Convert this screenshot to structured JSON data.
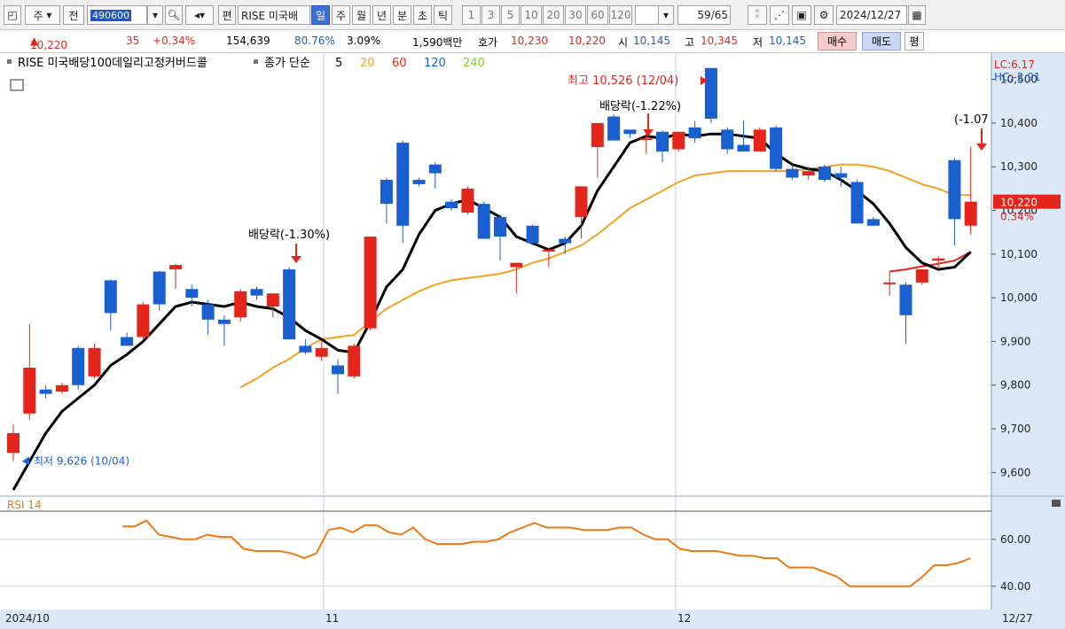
{
  "toolbar": {
    "period": "주",
    "prefix": "전",
    "code": "490600",
    "name": "RISE 미국배",
    "edit": "편",
    "tabs": [
      "일",
      "주",
      "월",
      "년",
      "분",
      "초",
      "틱"
    ],
    "active_tab": "일",
    "intervals": [
      "1",
      "3",
      "5",
      "10",
      "20",
      "30",
      "60",
      "120"
    ],
    "page": "59",
    "page_total": "/65",
    "date": "2024/12/27"
  },
  "quote": {
    "price": "10,220",
    "change": "35",
    "change_pct": "+0.34%",
    "volume": "154,639",
    "vol_ratio": "80.76%",
    "turnover": "3.09%",
    "amount": "1,590백만",
    "hoga_label": "호가",
    "ask": "10,230",
    "bid": "10,220",
    "open_label": "시",
    "open": "10,145",
    "high_label": "고",
    "high": "10,345",
    "low_label": "저",
    "low": "10,145",
    "buy_label": "매수",
    "sell_label": "매도",
    "flat_label": "평"
  },
  "colors": {
    "up": "#e3251b",
    "down": "#1a5fd0",
    "ma5": "#000000",
    "ma20": "#f5a020",
    "ma60": "#e3251b",
    "ma120": "#1a5fd0",
    "ma240": "#7ed321",
    "rsi": "#f07810",
    "axis_bg": "#dce6f4"
  },
  "chart_data": [
    {
      "type": "candlestick",
      "title": "RISE 미국배당100데일리고정커버드콜",
      "legend": [
        "종가 단순",
        "5",
        "20",
        "60",
        "120",
        "240"
      ],
      "y_ticks": [
        "10,500",
        "10,400",
        "10,300",
        "10,200",
        "10,100",
        "10,000",
        "9,900",
        "9,800",
        "9,700",
        "9,600"
      ],
      "ylim": [
        9550,
        10560
      ],
      "x_labels": [
        "2024/10",
        "11",
        "12",
        "12/27"
      ],
      "lc": "LC:6.17",
      "hc": "HC:-2.91",
      "current": "10,220",
      "current_pct": "0.34%",
      "annotations": [
        {
          "text": "최저 9,626 (10/04)"
        },
        {
          "text": "배당락(-1.30%)"
        },
        {
          "text": "배당락(-1.22%)"
        },
        {
          "text": "최고 10,526 (12/04)"
        },
        {
          "text": "(-1.07"
        }
      ],
      "candles": [
        {
          "o": 9645,
          "h": 9710,
          "l": 9626,
          "c": 9690
        },
        {
          "o": 9735,
          "h": 9940,
          "l": 9720,
          "c": 9840
        },
        {
          "o": 9790,
          "h": 9800,
          "l": 9770,
          "c": 9780
        },
        {
          "o": 9785,
          "h": 9805,
          "l": 9780,
          "c": 9800
        },
        {
          "o": 9885,
          "h": 9890,
          "l": 9790,
          "c": 9800
        },
        {
          "o": 9820,
          "h": 9895,
          "l": 9815,
          "c": 9885
        },
        {
          "o": 10040,
          "h": 10042,
          "l": 9925,
          "c": 9965
        },
        {
          "o": 9910,
          "h": 9920,
          "l": 9895,
          "c": 9890
        },
        {
          "o": 9910,
          "h": 9990,
          "l": 9905,
          "c": 9985
        },
        {
          "o": 10060,
          "h": 10062,
          "l": 9970,
          "c": 9985
        },
        {
          "o": 10065,
          "h": 10078,
          "l": 10020,
          "c": 10075
        },
        {
          "o": 10020,
          "h": 10030,
          "l": 9980,
          "c": 10000
        },
        {
          "o": 9985,
          "h": 9995,
          "l": 9915,
          "c": 9950
        },
        {
          "o": 9950,
          "h": 9960,
          "l": 9890,
          "c": 9940
        },
        {
          "o": 9955,
          "h": 10020,
          "l": 9945,
          "c": 10015
        },
        {
          "o": 10020,
          "h": 10025,
          "l": 9995,
          "c": 10005
        },
        {
          "o": 9980,
          "h": 10008,
          "l": 9955,
          "c": 10010
        },
        {
          "o": 10065,
          "h": 10070,
          "l": 9910,
          "c": 9905
        },
        {
          "o": 9890,
          "h": 9905,
          "l": 9870,
          "c": 9875
        },
        {
          "o": 9865,
          "h": 9900,
          "l": 9855,
          "c": 9885
        },
        {
          "o": 9845,
          "h": 9860,
          "l": 9780,
          "c": 9825
        },
        {
          "o": 9820,
          "h": 9895,
          "l": 9815,
          "c": 9890
        },
        {
          "o": 9930,
          "h": 10125,
          "l": 9925,
          "c": 10140
        },
        {
          "o": 10270,
          "h": 10275,
          "l": 10170,
          "c": 10215
        },
        {
          "o": 10355,
          "h": 10360,
          "l": 10125,
          "c": 10165
        },
        {
          "o": 10270,
          "h": 10275,
          "l": 10255,
          "c": 10260
        },
        {
          "o": 10305,
          "h": 10310,
          "l": 10250,
          "c": 10285
        },
        {
          "o": 10220,
          "h": 10225,
          "l": 10200,
          "c": 10205
        },
        {
          "o": 10195,
          "h": 10255,
          "l": 10190,
          "c": 10250
        },
        {
          "o": 10215,
          "h": 10220,
          "l": 10135,
          "c": 10135
        },
        {
          "o": 10185,
          "h": 10190,
          "l": 10085,
          "c": 10140
        },
        {
          "o": 10070,
          "h": 10080,
          "l": 10010,
          "c": 10080
        },
        {
          "o": 10165,
          "h": 10168,
          "l": 10120,
          "c": 10125
        },
        {
          "o": 10110,
          "h": 10115,
          "l": 10070,
          "c": 10110
        },
        {
          "o": 10135,
          "h": 10140,
          "l": 10100,
          "c": 10125
        },
        {
          "o": 10185,
          "h": 10255,
          "l": 10135,
          "c": 10255
        },
        {
          "o": 10345,
          "h": 10350,
          "l": 10275,
          "c": 10400
        },
        {
          "o": 10415,
          "h": 10420,
          "l": 10365,
          "c": 10360
        },
        {
          "o": 10385,
          "h": 10380,
          "l": 10365,
          "c": 10375
        },
        {
          "o": 10365,
          "h": 10385,
          "l": 10330,
          "c": 10365
        },
        {
          "o": 10380,
          "h": 10383,
          "l": 10310,
          "c": 10335
        },
        {
          "o": 10340,
          "h": 10380,
          "l": 10335,
          "c": 10380
        },
        {
          "o": 10390,
          "h": 10405,
          "l": 10355,
          "c": 10365
        },
        {
          "o": 10526,
          "h": 10526,
          "l": 10400,
          "c": 10410
        },
        {
          "o": 10385,
          "h": 10390,
          "l": 10330,
          "c": 10340
        },
        {
          "o": 10350,
          "h": 10405,
          "l": 10340,
          "c": 10335
        },
        {
          "o": 10335,
          "h": 10390,
          "l": 10335,
          "c": 10385
        },
        {
          "o": 10390,
          "h": 10395,
          "l": 10290,
          "c": 10295
        },
        {
          "o": 10295,
          "h": 10305,
          "l": 10270,
          "c": 10275
        },
        {
          "o": 10280,
          "h": 10300,
          "l": 10270,
          "c": 10290
        },
        {
          "o": 10300,
          "h": 10305,
          "l": 10265,
          "c": 10270
        },
        {
          "o": 10285,
          "h": 10300,
          "l": 10255,
          "c": 10275
        },
        {
          "o": 10265,
          "h": 10270,
          "l": 10170,
          "c": 10170
        },
        {
          "o": 10180,
          "h": 10185,
          "l": 10165,
          "c": 10165
        },
        {
          "o": 10035,
          "h": 10060,
          "l": 10005,
          "c": 10035
        },
        {
          "o": 10030,
          "h": 10035,
          "l": 9895,
          "c": 9960
        },
        {
          "o": 10035,
          "h": 10065,
          "l": 10030,
          "c": 10065
        },
        {
          "o": 10085,
          "h": 10095,
          "l": 10065,
          "c": 10090
        },
        {
          "o": 10315,
          "h": 10320,
          "l": 10120,
          "c": 10180
        },
        {
          "o": 10165,
          "h": 10345,
          "l": 10145,
          "c": 10220
        }
      ],
      "ma5": [
        9560,
        9625,
        9690,
        9740,
        9770,
        9800,
        9845,
        9870,
        9900,
        9940,
        9980,
        9990,
        9985,
        9980,
        9990,
        9980,
        9975,
        9955,
        9925,
        9905,
        9880,
        9875,
        9945,
        10025,
        10065,
        10145,
        10200,
        10215,
        10225,
        10205,
        10185,
        10140,
        10125,
        10110,
        10125,
        10165,
        10245,
        10300,
        10355,
        10370,
        10365,
        10375,
        10370,
        10375,
        10375,
        10370,
        10365,
        10330,
        10305,
        10295,
        10290,
        10270,
        10245,
        10215,
        10170,
        10115,
        10080,
        10065,
        10070,
        10105
      ],
      "ma20": [
        null,
        null,
        null,
        null,
        null,
        null,
        null,
        null,
        null,
        null,
        null,
        null,
        null,
        null,
        9795,
        9815,
        9840,
        9860,
        9885,
        9905,
        9910,
        9915,
        9945,
        9975,
        9995,
        10015,
        10030,
        10040,
        10045,
        10050,
        10055,
        10065,
        10080,
        10090,
        10105,
        10120,
        10145,
        10175,
        10205,
        10225,
        10245,
        10265,
        10280,
        10285,
        10290,
        10290,
        10290,
        10290,
        10290,
        10295,
        10300,
        10305,
        10305,
        10300,
        10290,
        10275,
        10260,
        10250,
        10235,
        10235
      ],
      "ma60": [
        null,
        null,
        null,
        null,
        null,
        null,
        null,
        null,
        null,
        null,
        null,
        null,
        null,
        null,
        null,
        null,
        null,
        null,
        null,
        null,
        null,
        null,
        null,
        null,
        null,
        null,
        null,
        null,
        null,
        null,
        null,
        null,
        null,
        null,
        null,
        null,
        null,
        null,
        null,
        null,
        null,
        null,
        null,
        null,
        null,
        null,
        null,
        null,
        null,
        null,
        null,
        null,
        null,
        null,
        10060,
        10065,
        10072,
        10078,
        10085,
        10105
      ]
    },
    {
      "type": "line",
      "title": "RSI 14",
      "y_ticks": [
        "60.00",
        "40.00"
      ],
      "ylim": [
        32,
        72
      ],
      "values": [
        null,
        null,
        null,
        null,
        null,
        null,
        null,
        null,
        null,
        null,
        null,
        null,
        null,
        null,
        null,
        null,
        null,
        null,
        null,
        null,
        null,
        null,
        null,
        null,
        null,
        null,
        null,
        null,
        null,
        null,
        null,
        null,
        null,
        null,
        null,
        null,
        null,
        null,
        null,
        null,
        null,
        null,
        null,
        null,
        null,
        null,
        null,
        null,
        null,
        null,
        null,
        null,
        null,
        null,
        null,
        null,
        null,
        null,
        null,
        null
      ]
    }
  ]
}
